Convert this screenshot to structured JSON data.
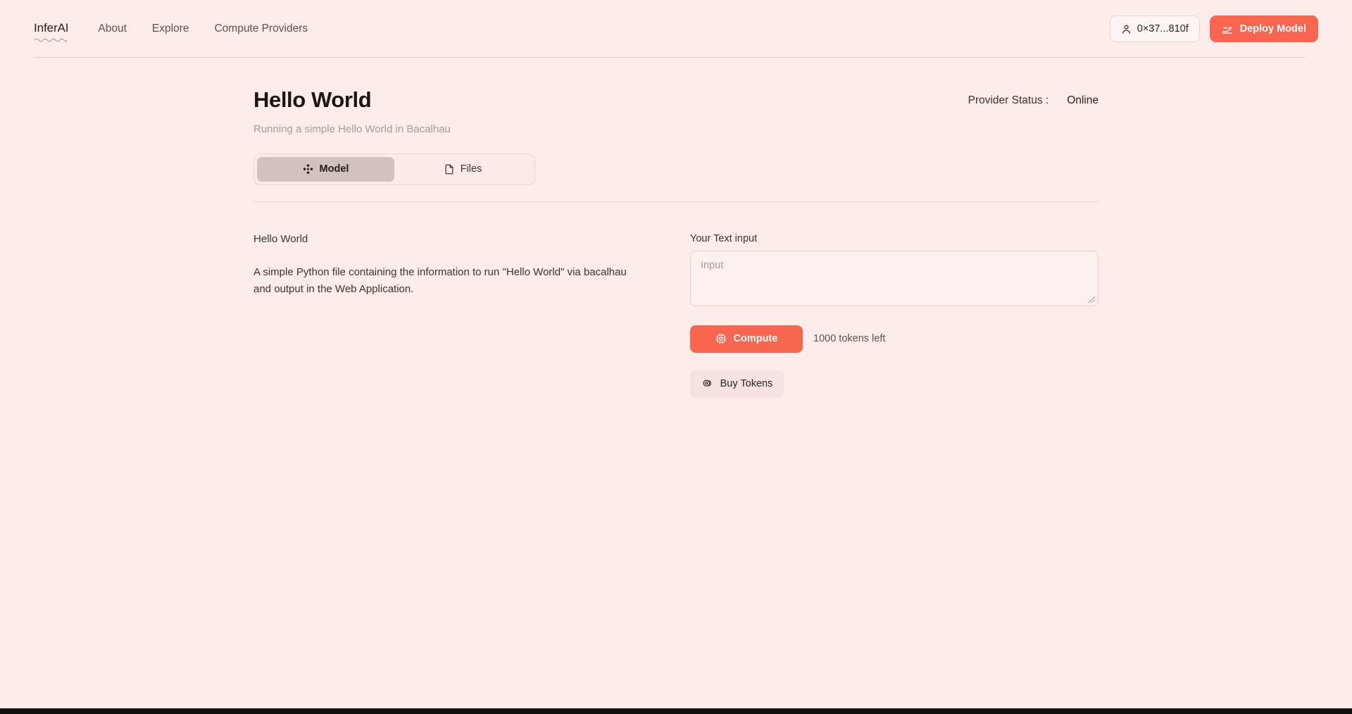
{
  "theme": {
    "background": "#fcecea",
    "accent": "#f9664f",
    "text": "#2b2321",
    "muted": "#a79a97",
    "tab_active_bg": "#d1c2bf",
    "divider": "#e2cfcd"
  },
  "header": {
    "logo": "InferAI",
    "logo_icon": "squiggle-underline-icon",
    "nav": [
      {
        "label": "About",
        "name": "nav-item-about"
      },
      {
        "label": "Explore",
        "name": "nav-item-explore"
      },
      {
        "label": "Compute Providers",
        "name": "nav-item-compute-providers"
      }
    ],
    "wallet": {
      "label": "0×37...810f",
      "icon": "user-icon"
    },
    "deploy": {
      "label": "Deploy Model",
      "icon": "rocket-takeoff-icon"
    }
  },
  "page": {
    "title": "Hello World",
    "subtitle": "Running a simple Hello World in Bacalhau",
    "status_label": "Provider Status :",
    "status_value": "Online"
  },
  "tabs": [
    {
      "label": "Model",
      "icon": "diamonds-icon",
      "active": true,
      "name": "tab-model"
    },
    {
      "label": "Files",
      "icon": "file-icon",
      "active": false,
      "name": "tab-files"
    }
  ],
  "description": {
    "heading": "Hello World",
    "body": "A simple Python file containing the information to run \"Hello World\" via bacalhau and output in the Web Application."
  },
  "input_panel": {
    "label": "Your Text input",
    "value": "",
    "placeholder": "Input",
    "compute_button": "Compute",
    "compute_icon": "cpu-chip-icon",
    "tokens_left": "1000 tokens left",
    "buy_button": "Buy Tokens",
    "buy_icon": "coins-icon"
  }
}
